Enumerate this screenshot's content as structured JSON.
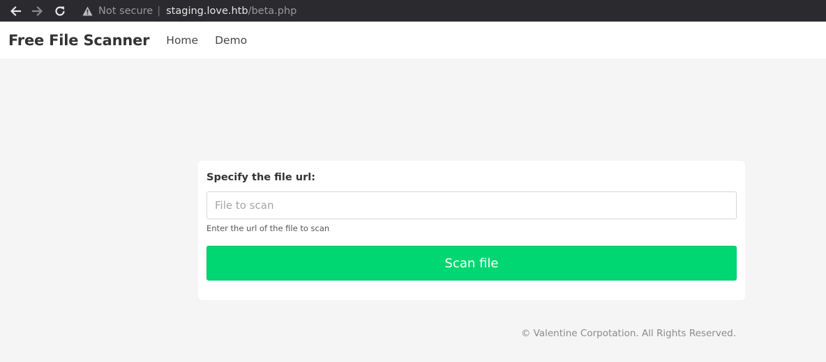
{
  "browser": {
    "back_icon": "arrow-left-icon",
    "forward_icon": "arrow-right-icon",
    "reload_icon": "reload-icon",
    "warning_icon": "warning-triangle-icon",
    "security_text": "Not secure",
    "separator": "|",
    "url_host": "staging.love.htb",
    "url_path": "/beta.php"
  },
  "navbar": {
    "brand": "Free File Scanner",
    "links": [
      "Home",
      "Demo"
    ]
  },
  "form": {
    "label": "Specify the file url:",
    "input_value": "",
    "input_placeholder": "File to scan",
    "help_text": "Enter the url of the file to scan",
    "submit_label": "Scan file"
  },
  "footer": {
    "text": "© Valentine Corpotation. All Rights Reserved."
  },
  "colors": {
    "browser_bar": "#2b2b2f",
    "background": "#f5f5f5",
    "button": "#00d672"
  }
}
